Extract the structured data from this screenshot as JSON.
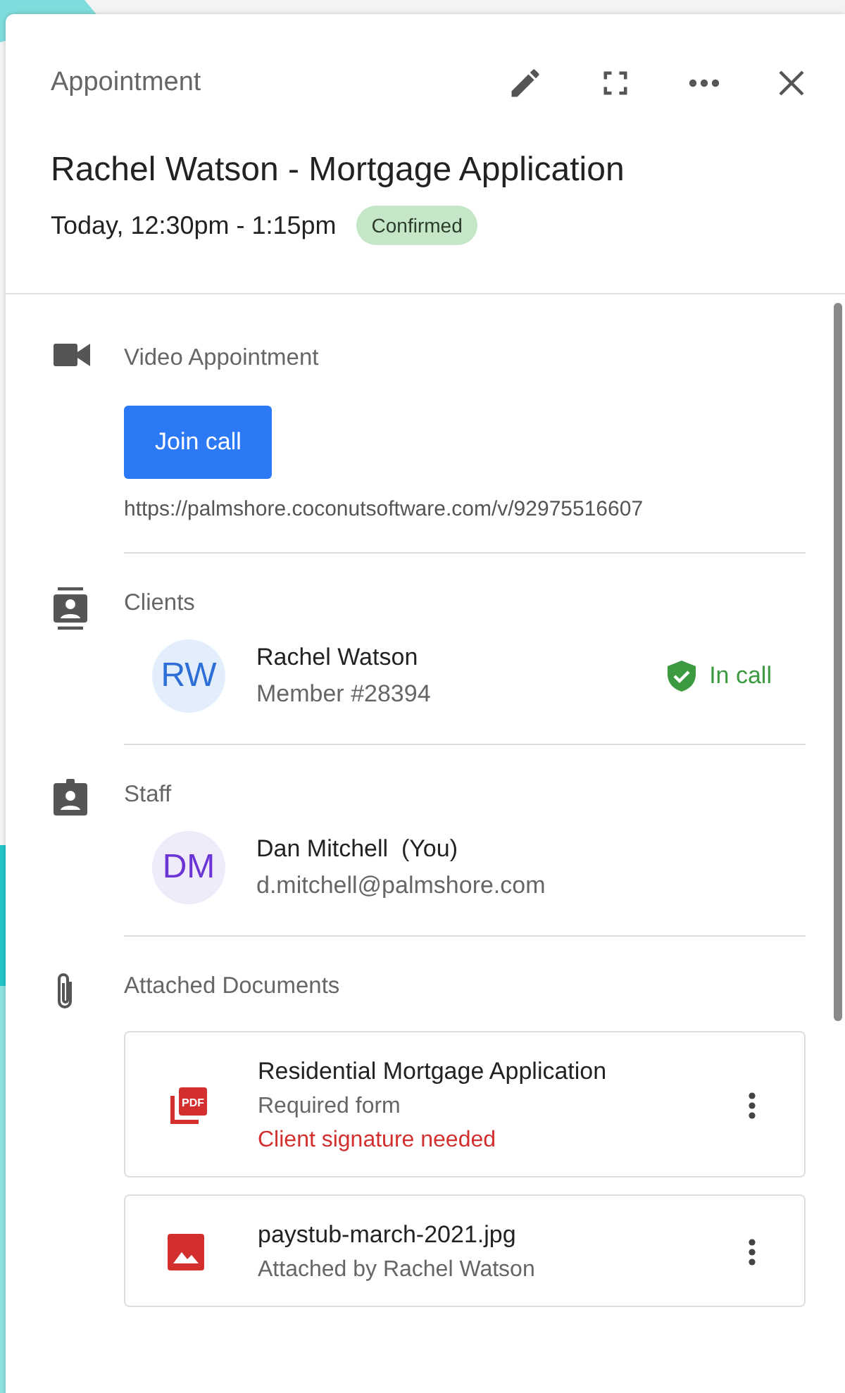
{
  "header": {
    "label": "Appointment",
    "title": "Rachel Watson - Mortgage Application",
    "time": "Today, 12:30pm - 1:15pm",
    "status": "Confirmed"
  },
  "sections": [
    {
      "kind": "video",
      "heading": "Video Appointment",
      "button": "Join call",
      "link": "https://palmshore.coconutsoftware.com/v/92975516607"
    },
    {
      "kind": "clients",
      "heading": "Clients",
      "people": [
        {
          "initials": "RW",
          "name": "Rachel Watson",
          "detail": "Member #28394",
          "status": "In call"
        }
      ]
    },
    {
      "kind": "staff",
      "heading": "Staff",
      "people": [
        {
          "initials": "DM",
          "name": "Dan Mitchell  (You)",
          "detail": "d.mitchell@palmshore.com"
        }
      ]
    },
    {
      "kind": "documents",
      "heading": "Attached Documents",
      "documents": [
        {
          "kind": "pdf",
          "icon_label": "PDF",
          "name": "Residential Mortgage Application",
          "detail": "Required form",
          "warning": "Client signature needed"
        },
        {
          "kind": "image",
          "name": "paystub-march-2021.jpg",
          "detail": "Attached by Rachel Watson"
        }
      ]
    }
  ]
}
